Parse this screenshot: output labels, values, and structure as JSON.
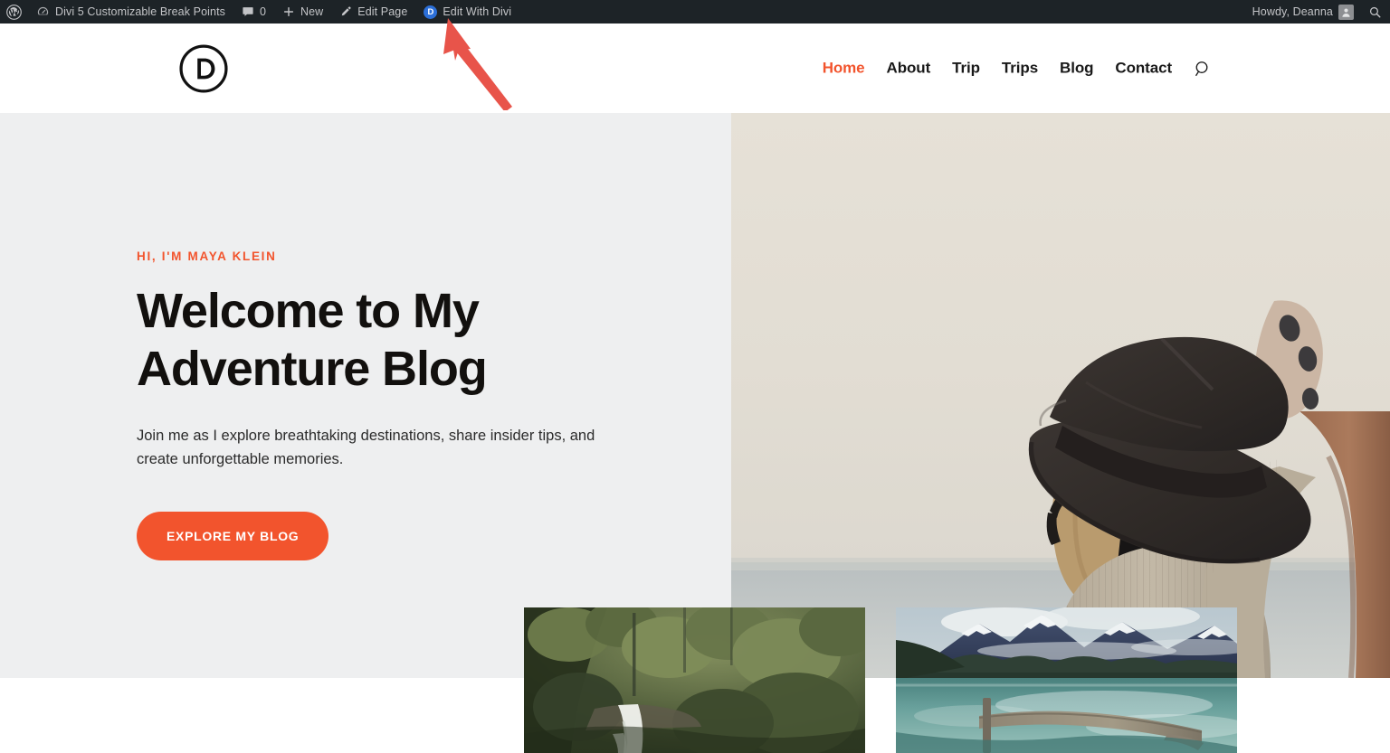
{
  "admin_bar": {
    "wp_logo_icon": "wordpress-logo-icon",
    "site_icon": "dashboard-speedometer-icon",
    "site_name": "Divi 5 Customizable Break Points",
    "comments_icon": "comment-bubble-icon",
    "comments_count": "0",
    "new_icon": "plus-icon",
    "new_label": "New",
    "edit_page_icon": "pencil-icon",
    "edit_page_label": "Edit Page",
    "divi_badge_letter": "D",
    "edit_with_divi_label": "Edit With Divi",
    "howdy_label": "Howdy, Deanna",
    "avatar_icon": "user-avatar-icon",
    "search_icon": "search-icon"
  },
  "site_header": {
    "logo_icon": "divi-circled-d-logo",
    "logo_letter": "D",
    "nav": [
      {
        "label": "Home",
        "active": true
      },
      {
        "label": "About",
        "active": false
      },
      {
        "label": "Trip",
        "active": false
      },
      {
        "label": "Trips",
        "active": false
      },
      {
        "label": "Blog",
        "active": false
      },
      {
        "label": "Contact",
        "active": false
      }
    ],
    "search_icon": "search-icon"
  },
  "hero": {
    "eyebrow": "HI, I'M MAYA KLEIN",
    "title": "Welcome to My Adventure Blog",
    "subtitle": "Join me as I explore breathtaking destinations, share insider tips, and create unforgettable memories.",
    "cta_label": "EXPLORE MY BLOG",
    "background_color": "#eeeff0",
    "image_alt": "Woman wearing a black fedora hat and beige knit sweater seen from behind against a pale sky and sea"
  },
  "cards": [
    {
      "alt": "Forest waterfall surrounded by dense green trees"
    },
    {
      "alt": "Mountain lake with a wooden dock and snow-capped peaks"
    }
  ],
  "annotation": {
    "arrow_color": "#e8544a",
    "points_to": "Edit With Divi"
  },
  "colors": {
    "accent_orange": "#f2542d",
    "admin_bar_bg": "#1d2327",
    "hero_bg": "#eeeff0",
    "text_dark": "#12100e",
    "divi_blue": "#2c6fd8"
  }
}
